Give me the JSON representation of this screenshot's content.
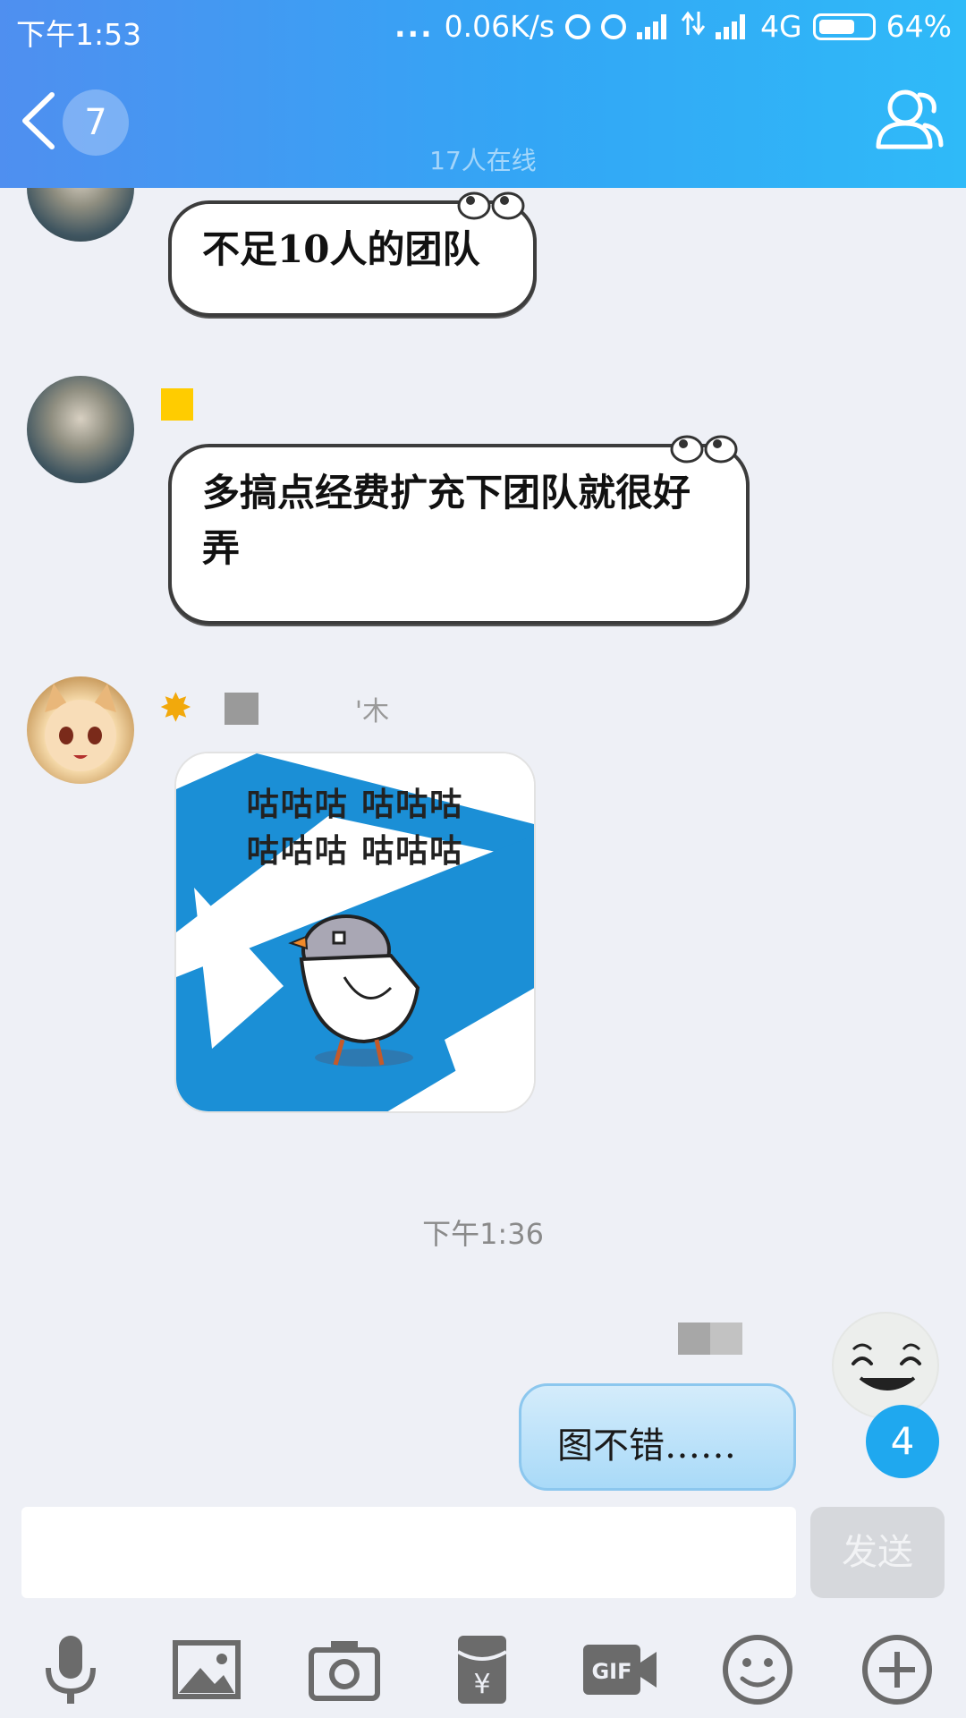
{
  "status_bar": {
    "time": "下午1:53",
    "dots": "...",
    "net_speed": "0.06K/s",
    "network": "4G",
    "battery": "64%"
  },
  "header": {
    "unread": "7",
    "online_status": "17人在线"
  },
  "messages": [
    {
      "text": "不足10人的团队"
    },
    {
      "text": "多搞点经费扩充下团队就很好弄"
    },
    {
      "name_suffix": "'木",
      "sticker_line1": "咕咕咕  咕咕咕",
      "sticker_line2": "咕咕咕  咕咕咕"
    }
  ],
  "timestamp": "下午1:36",
  "my_message": {
    "text": "图不错……",
    "unread_badge": "4"
  },
  "input": {
    "placeholder": "",
    "send_label": "发送"
  },
  "toolbar": {
    "icons": [
      "microphone-icon",
      "image-icon",
      "camera-icon",
      "red-packet-icon",
      "gif-icon",
      "emoji-icon",
      "plus-icon"
    ]
  },
  "colors": {
    "accent": "#33a6f5",
    "header_start": "#4f8ff0",
    "badge": "#1fa8ef"
  }
}
